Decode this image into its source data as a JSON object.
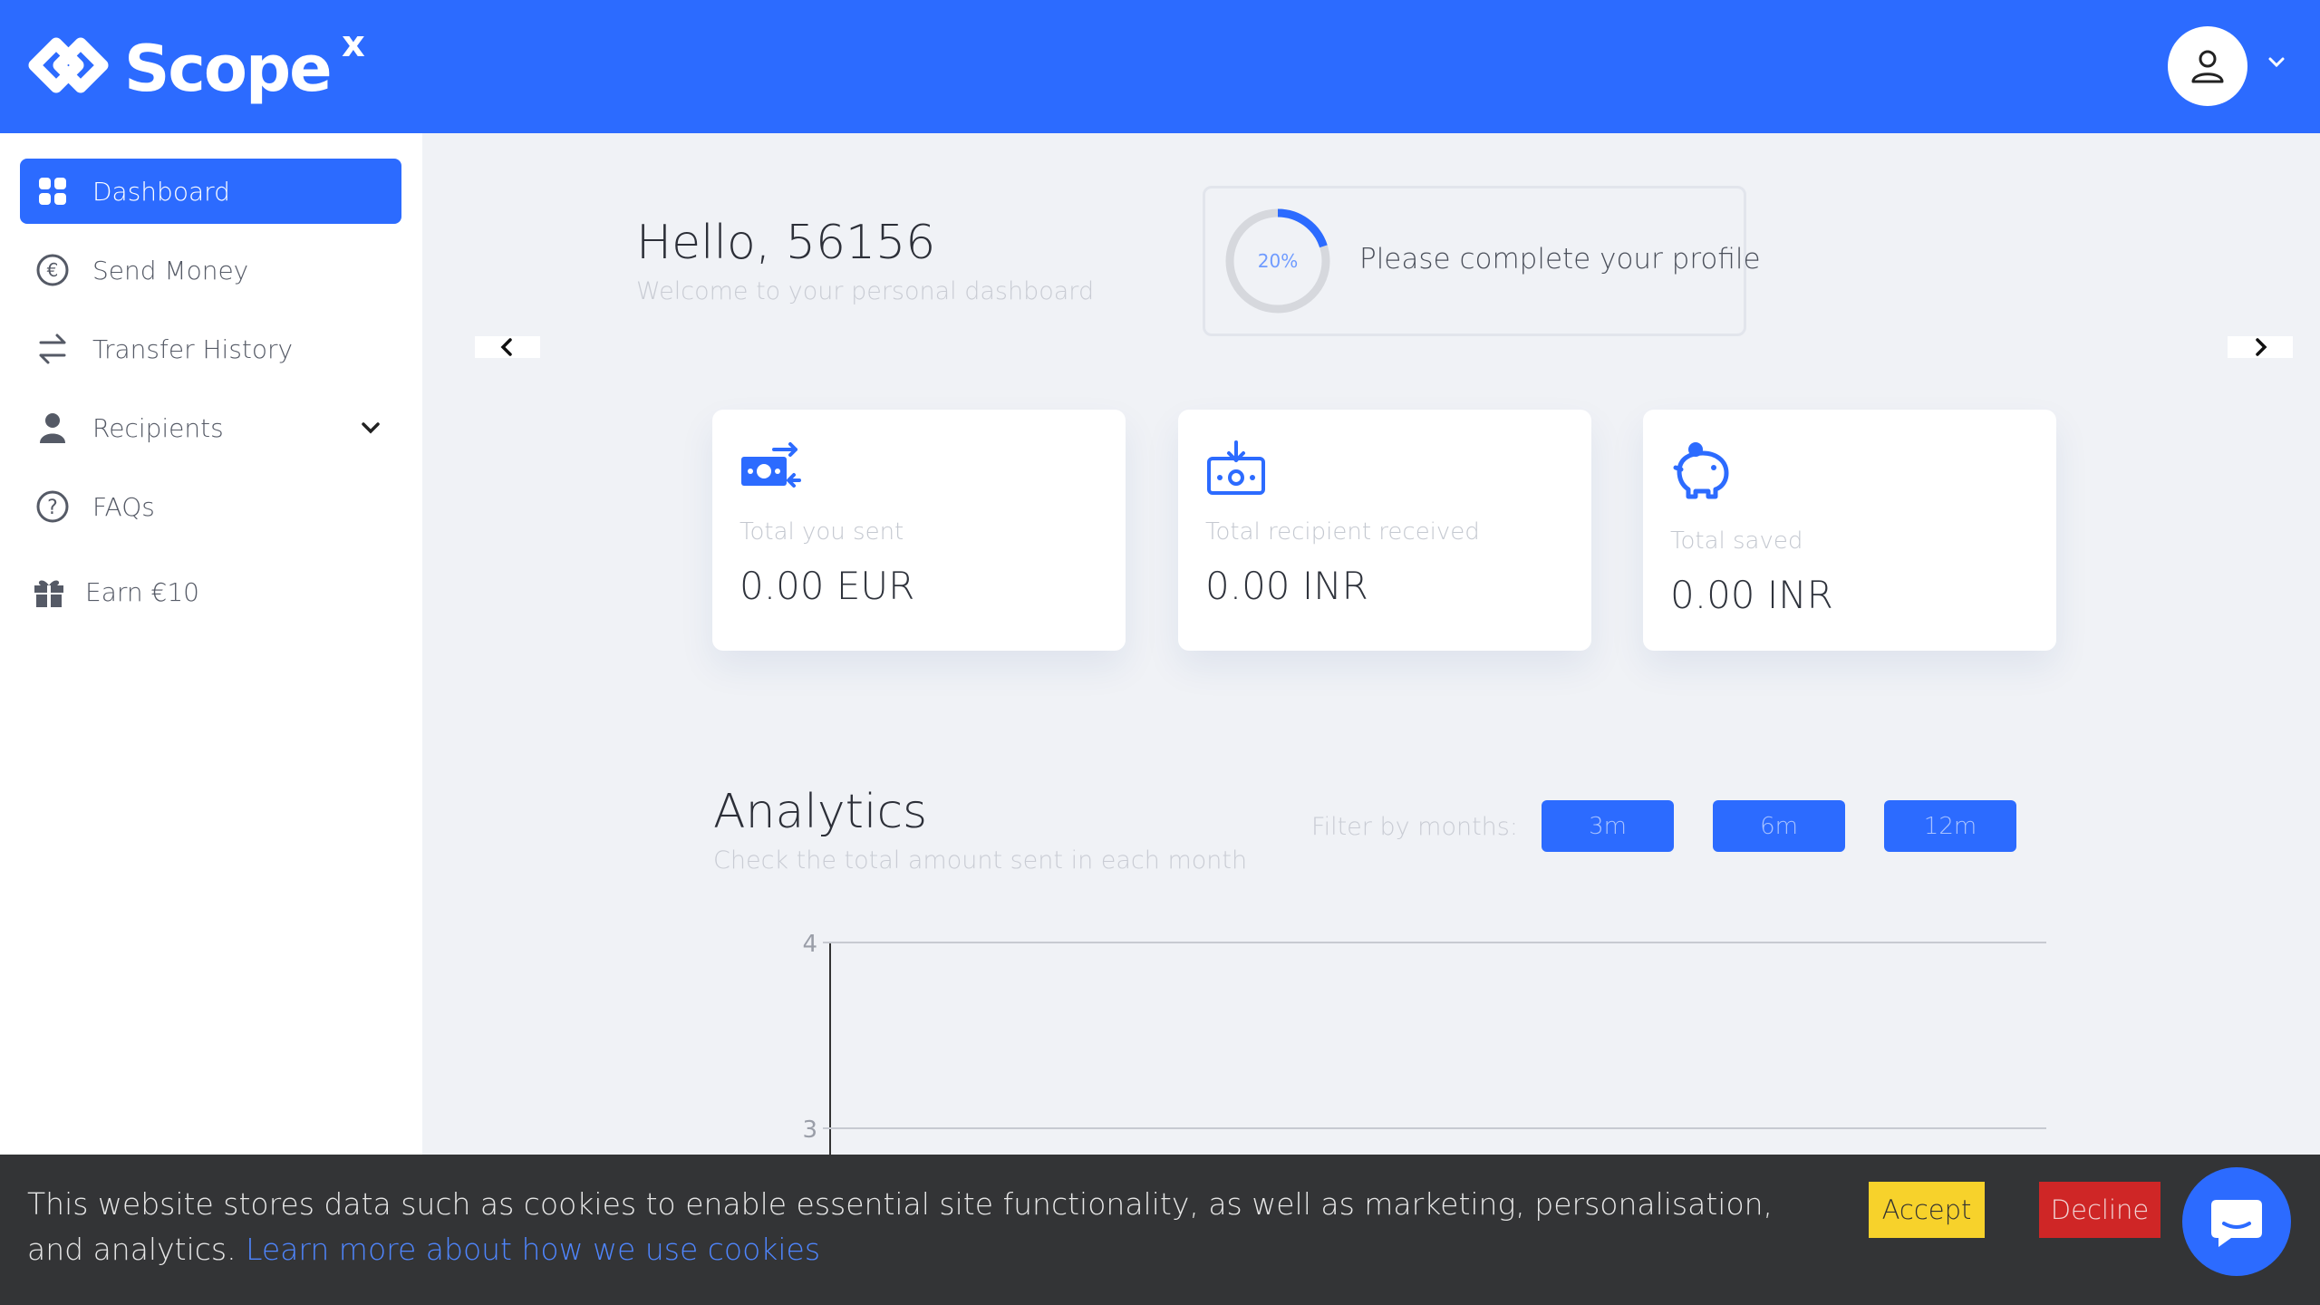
{
  "header": {
    "brand": "Scope",
    "brand_superscript": "x",
    "avatar_icon": "user-icon",
    "menu_icon": "chevron-down-icon"
  },
  "sidebar": {
    "items": [
      {
        "label": "Dashboard",
        "icon": "grid-icon",
        "active": true
      },
      {
        "label": "Send Money",
        "icon": "euro-circle-icon"
      },
      {
        "label": "Transfer History",
        "icon": "swap-arrows-icon"
      },
      {
        "label": "Recipients",
        "icon": "person-icon",
        "expandable": true
      },
      {
        "label": "FAQs",
        "icon": "question-circle-icon"
      },
      {
        "label": "Earn €10",
        "icon": "gift-icon"
      }
    ]
  },
  "greeting": {
    "title": "Hello, 56156",
    "subtitle": "Welcome to your personal dashboard"
  },
  "profile": {
    "progress_label": "20%",
    "progress": 0.2,
    "message": "Please complete your profile"
  },
  "stats": [
    {
      "label": "Total you sent",
      "value": "0.00 EUR",
      "icon": "money-transfer-icon"
    },
    {
      "label": "Total recipient received",
      "value": "0.00 INR",
      "icon": "receive-money-icon"
    },
    {
      "label": "Total saved",
      "value": "0.00 INR",
      "icon": "piggy-bank-icon"
    }
  ],
  "analytics": {
    "title": "Analytics",
    "subtitle": "Check the total amount sent in each month",
    "filter_label": "Filter by months:",
    "filters": [
      "3m",
      "6m",
      "12m"
    ]
  },
  "chart_data": {
    "type": "bar",
    "y_ticks": [
      "4",
      "3"
    ],
    "grid": true
  },
  "cookie": {
    "text": "This website stores data such as cookies to enable essential site functionality, as well as marketing, personalisation, and analytics.",
    "link": "Learn more about how we use cookies",
    "accept": "Accept",
    "decline": "Decline"
  },
  "colors": {
    "brand": "#2c6bff",
    "accept": "#f7d22b",
    "decline": "#cf2626"
  }
}
